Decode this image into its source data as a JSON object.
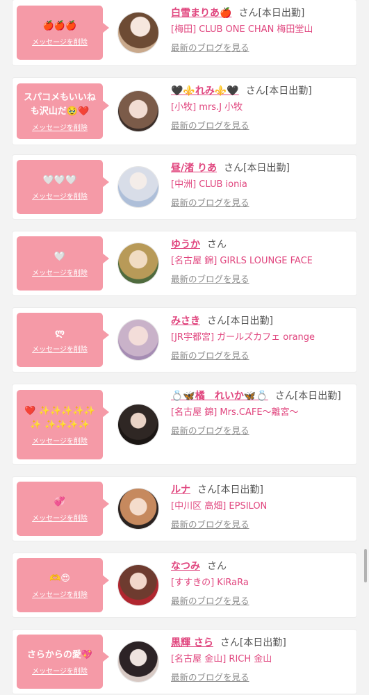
{
  "delete_label": "メッセージを削除",
  "blog_label": "最新のブログを見る",
  "san_label": "さん",
  "colors": {
    "accent": "#e0457e",
    "bubble": "#f59aa7"
  },
  "cards": [
    {
      "message": "🍎🍎🍎",
      "name": "白雪まりあ🍎",
      "status": "[本日出勤]",
      "shop": "[梅田] CLUB ONE CHAN 梅田堂山",
      "avatar_icon": "avatar-1"
    },
    {
      "message": "スパコメもいいねも沢山だ🥹❤️",
      "name": "🖤⚜️れみ⚜️🖤",
      "status": "[本日出勤]",
      "shop": "[小牧] mrs.J 小牧",
      "avatar_icon": "avatar-2"
    },
    {
      "message": "🤍🤍🤍",
      "name": "昼/渚 りあ",
      "status": "[本日出勤]",
      "shop": "[中洲] CLUB ionia",
      "avatar_icon": "avatar-3"
    },
    {
      "message": "🤍",
      "name": "ゆうか",
      "status": "",
      "shop": "[名古屋 錦] GIRLS LOUNGE FACE",
      "avatar_icon": "avatar-4"
    },
    {
      "message": "ლ",
      "name": "みさき",
      "status": "[本日出勤]",
      "shop": "[JR宇都宮] ガールズカフェ orange",
      "avatar_icon": "avatar-5"
    },
    {
      "message": "❤️ ✨✨✨✨✨✨ ✨✨✨✨",
      "name": "💍🦋橘　れいか🦋💍",
      "status": "[本日出勤]",
      "shop": "[名古屋 錦] Mrs.CAFE〜離宮〜",
      "avatar_icon": "avatar-6"
    },
    {
      "message": "💞",
      "name": "ルナ",
      "status": "[本日出勤]",
      "shop": "[中川区 高畑] EPSILON",
      "avatar_icon": "avatar-7"
    },
    {
      "message": "🫶😍",
      "name": "なつみ",
      "status": "",
      "shop": "[すすきの] KiRaRa",
      "avatar_icon": "avatar-8"
    },
    {
      "message": "さらからの愛💖",
      "name": "黒輝 さら",
      "status": "[本日出勤]",
      "shop": "[名古屋 金山] RICH 金山",
      "avatar_icon": "avatar-9"
    }
  ]
}
